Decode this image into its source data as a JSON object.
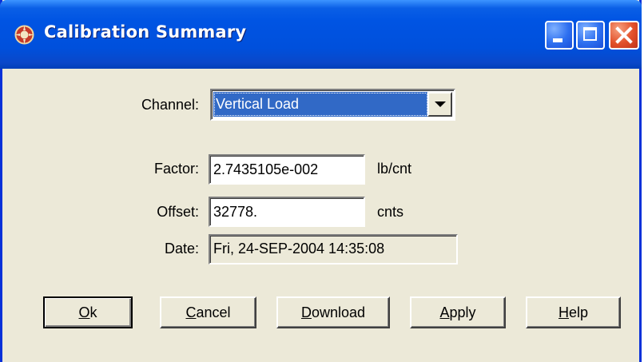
{
  "window": {
    "title": "Calibration Summary",
    "icons": {
      "app": "emblem-icon",
      "minimize": "minimize-icon",
      "maximize": "maximize-icon",
      "close": "close-icon"
    }
  },
  "channel": {
    "label": "Channel:",
    "selected": "Vertical Load"
  },
  "factor": {
    "label": "Factor:",
    "value": "2.7435105e-002",
    "unit": "lb/cnt"
  },
  "offset": {
    "label": "Offset:",
    "value": "32778.",
    "unit": "cnts"
  },
  "date": {
    "label": "Date:",
    "value": "Fri, 24-SEP-2004 14:35:08"
  },
  "buttons": {
    "ok": {
      "mnemonic": "O",
      "rest": "k"
    },
    "cancel": {
      "mnemonic": "C",
      "rest": "ancel"
    },
    "download": {
      "mnemonic": "D",
      "rest": "ownload"
    },
    "apply": {
      "mnemonic": "A",
      "rest": "pply"
    },
    "help": {
      "mnemonic": "H",
      "rest": "elp"
    }
  },
  "colors": {
    "title_bar": "#0054e3",
    "face": "#ece9d8",
    "selection": "#3169c6",
    "close_button": "#e2502a"
  }
}
